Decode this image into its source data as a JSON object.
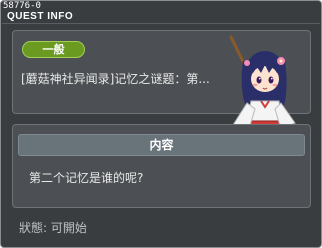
{
  "window": {
    "quest_id": "58776-0",
    "title": "QUEST INFO"
  },
  "quest": {
    "category_badge": "一般",
    "name": "[蘑菇神社异闻录]记忆之谜题：第..."
  },
  "content": {
    "header": "内容",
    "text": "第二个记忆是谁的呢?"
  },
  "status": {
    "text": "狀態:  可開始"
  },
  "colors": {
    "badge_green": "#6a9a20",
    "panel_bg": "#4c5054",
    "window_bg": "#3a3d40",
    "header_bg": "#68737a"
  },
  "icons": {
    "character": "shrine-maiden-with-broom"
  }
}
